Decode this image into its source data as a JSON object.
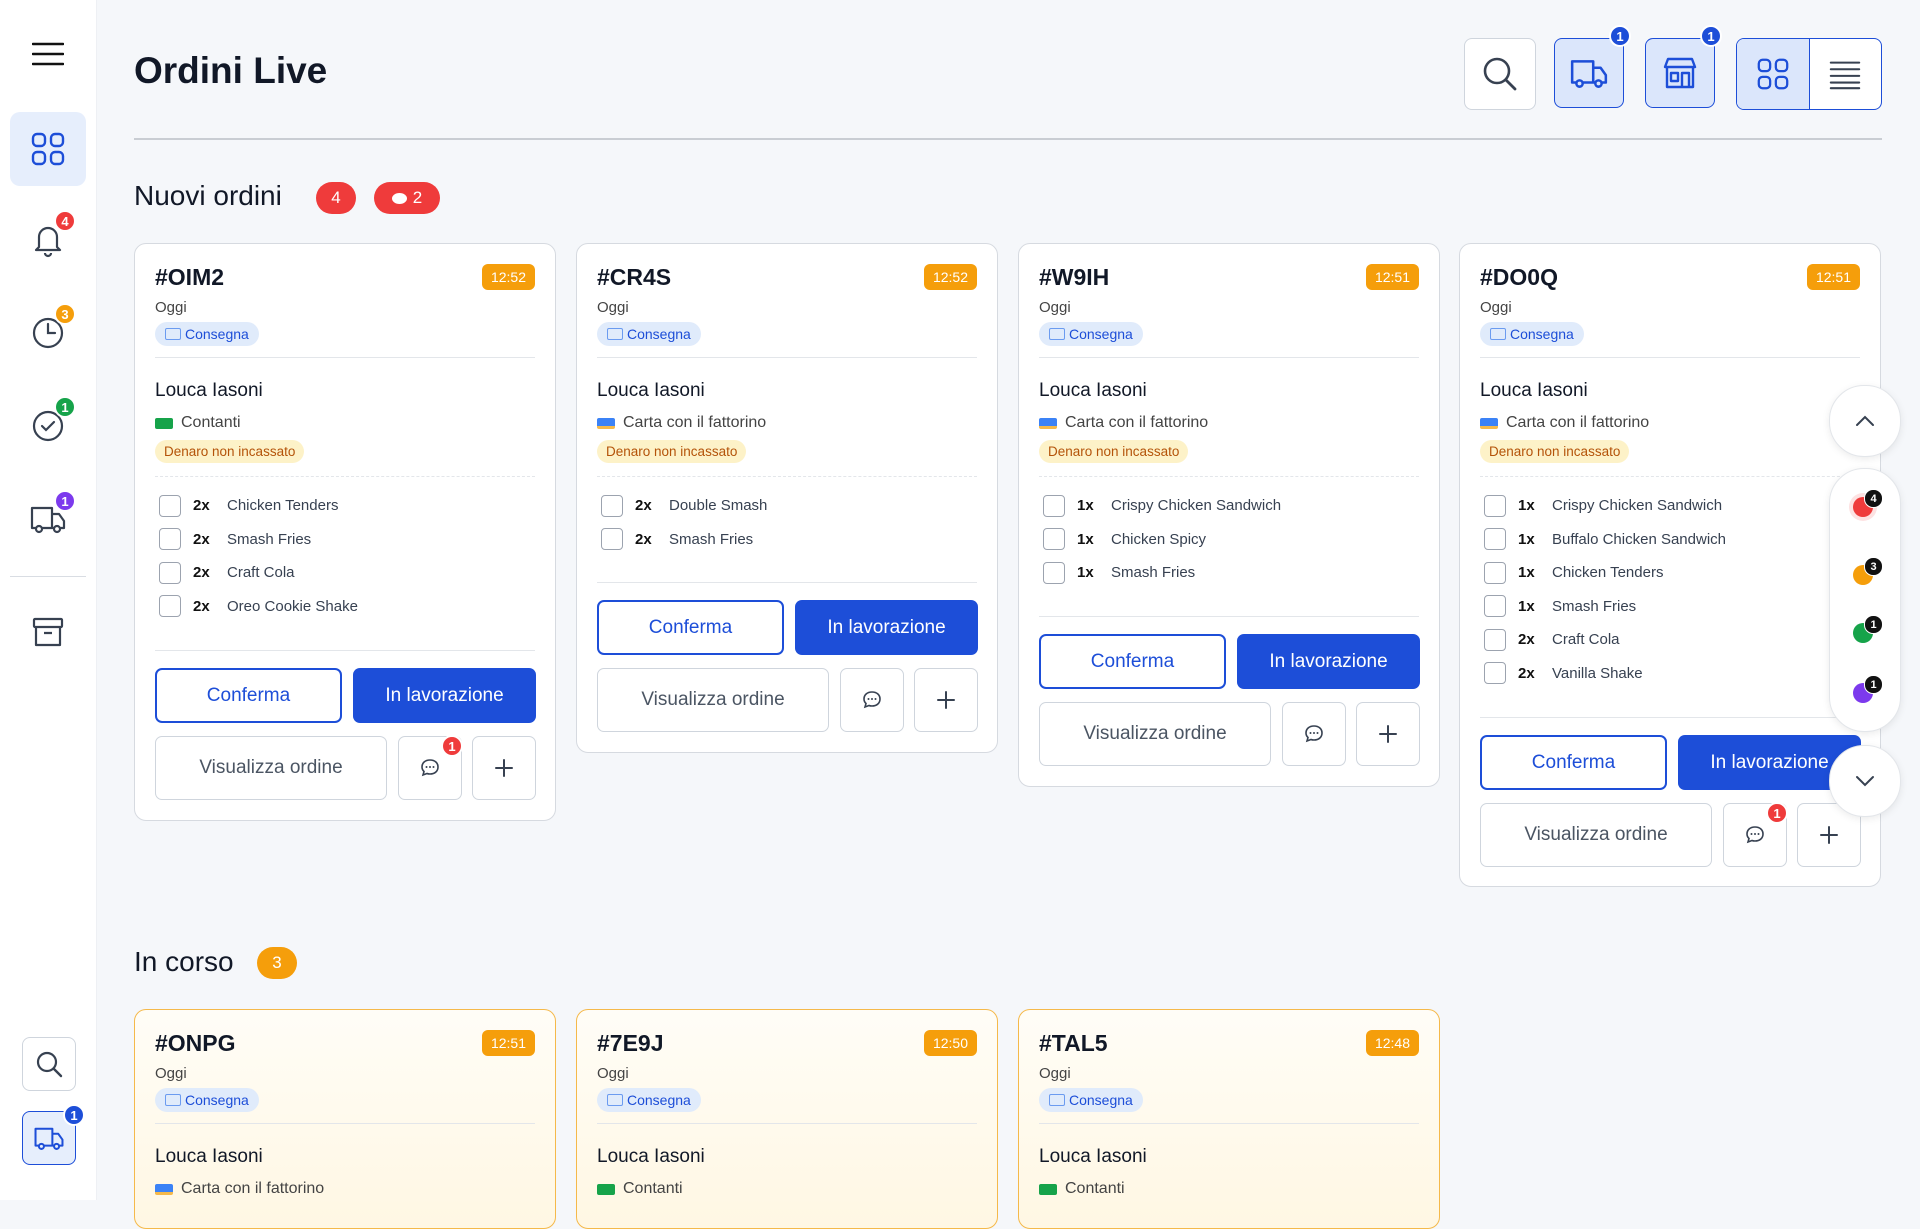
{
  "page_title": "Ordini Live",
  "sidebar": {
    "items": [
      {
        "name": "dashboard",
        "badge": null
      },
      {
        "name": "notifications",
        "badge": "4"
      },
      {
        "name": "pending",
        "badge": "3"
      },
      {
        "name": "completed",
        "badge": "1"
      },
      {
        "name": "delivery",
        "badge": "1"
      }
    ],
    "delivery_bottom_badge": "1"
  },
  "header": {
    "delivery_badge": "1",
    "store_badge": "1"
  },
  "sections": {
    "new": {
      "title": "Nuovi ordini",
      "count": "4",
      "messages": "2"
    },
    "progress": {
      "title": "In corso",
      "count": "3"
    }
  },
  "labels": {
    "confirm": "Conferma",
    "working": "In lavorazione",
    "view": "Visualizza ordine",
    "delivery": "Consegna",
    "unpaid": "Denaro non incassato"
  },
  "new_orders": [
    {
      "id": "#OIM2",
      "time": "12:52",
      "day": "Oggi",
      "customer": "Louca Iasoni",
      "payment": "Contanti",
      "chat_badge": "1",
      "items": [
        {
          "qty": "2x",
          "name": "Chicken Tenders"
        },
        {
          "qty": "2x",
          "name": "Smash Fries"
        },
        {
          "qty": "2x",
          "name": "Craft Cola"
        },
        {
          "qty": "2x",
          "name": "Oreo Cookie Shake"
        }
      ]
    },
    {
      "id": "#CR4S",
      "time": "12:52",
      "day": "Oggi",
      "customer": "Louca Iasoni",
      "payment": "Carta con il fattorino",
      "chat_badge": null,
      "items": [
        {
          "qty": "2x",
          "name": "Double Smash"
        },
        {
          "qty": "2x",
          "name": "Smash Fries"
        }
      ]
    },
    {
      "id": "#W9IH",
      "time": "12:51",
      "day": "Oggi",
      "customer": "Louca Iasoni",
      "payment": "Carta con il fattorino",
      "chat_badge": null,
      "items": [
        {
          "qty": "1x",
          "name": "Crispy Chicken Sandwich"
        },
        {
          "qty": "1x",
          "name": "Chicken Spicy"
        },
        {
          "qty": "1x",
          "name": "Smash Fries"
        }
      ]
    },
    {
      "id": "#DO0Q",
      "time": "12:51",
      "day": "Oggi",
      "customer": "Louca Iasoni",
      "payment": "Carta con il fattorino",
      "chat_badge": "1",
      "items": [
        {
          "qty": "1x",
          "name": "Crispy Chicken Sandwich"
        },
        {
          "qty": "1x",
          "name": "Buffalo Chicken Sandwich"
        },
        {
          "qty": "1x",
          "name": "Chicken Tenders"
        },
        {
          "qty": "1x",
          "name": "Smash Fries"
        },
        {
          "qty": "2x",
          "name": "Craft Cola"
        },
        {
          "qty": "2x",
          "name": "Vanilla Shake"
        }
      ]
    }
  ],
  "progress_orders": [
    {
      "id": "#ONPG",
      "time": "12:51",
      "day": "Oggi",
      "customer": "Louca Iasoni",
      "payment": "Carta con il fattorino"
    },
    {
      "id": "#7E9J",
      "time": "12:50",
      "day": "Oggi",
      "customer": "Louca Iasoni",
      "payment": "Contanti"
    },
    {
      "id": "#TAL5",
      "time": "12:48",
      "day": "Oggi",
      "customer": "Louca Iasoni",
      "payment": "Contanti"
    }
  ],
  "float_nav": {
    "dots": [
      {
        "color": "#ef3b3b",
        "count": "4"
      },
      {
        "color": "#f59e0b",
        "count": "3"
      },
      {
        "color": "#16a34a",
        "count": "1"
      },
      {
        "color": "#7c3aed",
        "count": "1"
      }
    ]
  }
}
